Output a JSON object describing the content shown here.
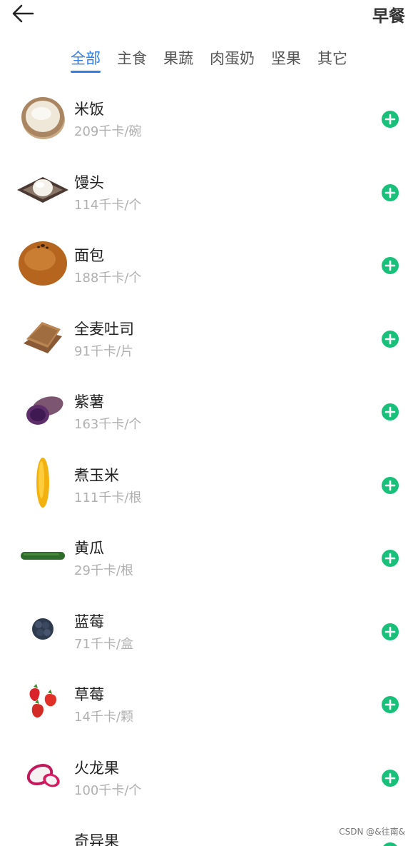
{
  "header": {
    "title": "早餐",
    "back_icon": "arrow-left-icon"
  },
  "tabs": [
    {
      "label": "全部",
      "active": true
    },
    {
      "label": "主食",
      "active": false
    },
    {
      "label": "果蔬",
      "active": false
    },
    {
      "label": "肉蛋奶",
      "active": false
    },
    {
      "label": "坚果",
      "active": false
    },
    {
      "label": "其它",
      "active": false
    }
  ],
  "foods": [
    {
      "name": "米饭",
      "kcal": "209千卡/碗",
      "icon": "rice-bowl-icon"
    },
    {
      "name": "馒头",
      "kcal": "114千卡/个",
      "icon": "steamed-bun-icon"
    },
    {
      "name": "面包",
      "kcal": "188千卡/个",
      "icon": "bread-icon"
    },
    {
      "name": "全麦吐司",
      "kcal": "91千卡/片",
      "icon": "toast-icon"
    },
    {
      "name": "紫薯",
      "kcal": "163千卡/个",
      "icon": "purple-sweet-potato-icon"
    },
    {
      "name": "煮玉米",
      "kcal": "111千卡/根",
      "icon": "corn-icon"
    },
    {
      "name": "黄瓜",
      "kcal": "29千卡/根",
      "icon": "cucumber-icon"
    },
    {
      "name": "蓝莓",
      "kcal": "71千卡/盒",
      "icon": "blueberry-icon"
    },
    {
      "name": "草莓",
      "kcal": "14千卡/颗",
      "icon": "strawberry-icon"
    },
    {
      "name": "火龙果",
      "kcal": "100千卡/个",
      "icon": "dragon-fruit-icon"
    },
    {
      "name": "奇异果",
      "kcal": "",
      "icon": "kiwi-icon"
    }
  ],
  "colors": {
    "accent": "#2f7fe6",
    "add_button": "#19c07a",
    "subtext": "#b0b0b0"
  },
  "watermark": "CSDN @&往南&"
}
